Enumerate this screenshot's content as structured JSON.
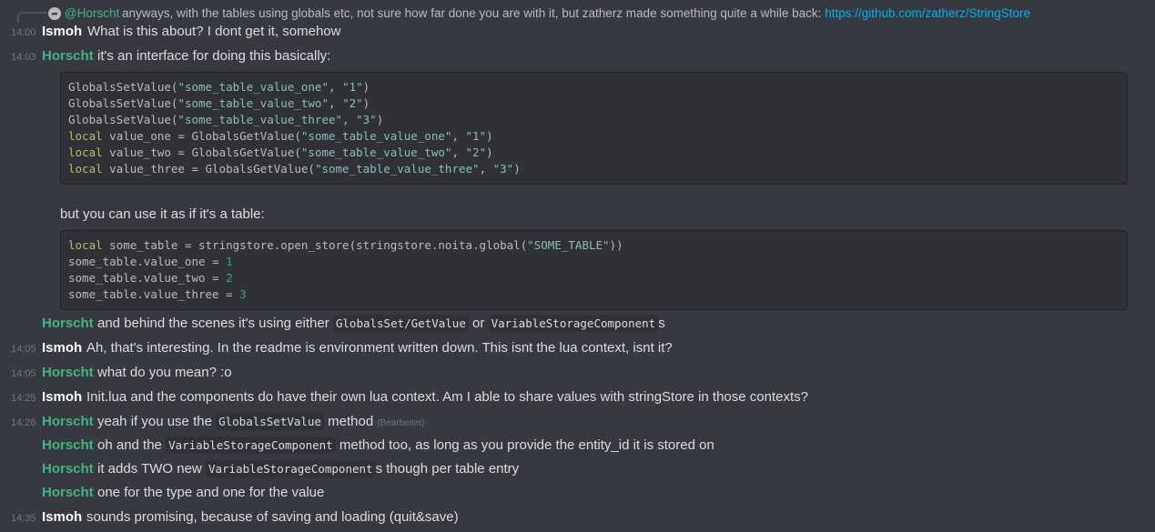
{
  "reply": {
    "mention": "@Horscht",
    "text": "anyways, with the tables using globals etc, not sure how far done you are with it, but zatherz made something quite a while back:",
    "link": "https://github.com/zatherz/StringStore"
  },
  "messages": [
    {
      "time": "14:00",
      "author": "Ismoh",
      "text": "What is this about? I dont get it, somehow"
    },
    {
      "time": "14:03",
      "author": "Horscht",
      "text": "it's an interface for doing this basically:"
    }
  ],
  "code1": [
    {
      "pre": "GlobalsSetValue(",
      "s1": "\"some_table_value_one\"",
      "mid": ", ",
      "s2": "\"1\"",
      "post": ")",
      "kw": ""
    },
    {
      "pre": "GlobalsSetValue(",
      "s1": "\"some_table_value_two\"",
      "mid": ", ",
      "s2": "\"2\"",
      "post": ")",
      "kw": ""
    },
    {
      "pre": "GlobalsSetValue(",
      "s1": "\"some_table_value_three\"",
      "mid": ", ",
      "s2": "\"3\"",
      "post": ")",
      "kw": ""
    },
    {
      "kw": "local",
      "pre": " value_one = GlobalsGetValue(",
      "s1": "\"some_table_value_one\"",
      "mid": ", ",
      "s2": "\"1\"",
      "post": ")"
    },
    {
      "kw": "local",
      "pre": " value_two = GlobalsGetValue(",
      "s1": "\"some_table_value_two\"",
      "mid": ", ",
      "s2": "\"2\"",
      "post": ")"
    },
    {
      "kw": "local",
      "pre": " value_three = GlobalsGetValue(",
      "s1": "\"some_table_value_three\"",
      "mid": ", ",
      "s2": "\"3\"",
      "post": ")"
    }
  ],
  "but_text": "but you can use it as if it's a table:",
  "code2": {
    "line1_kw": "local",
    "line1_pre": " some_table = stringstore.open_store(stringstore.noita.global(",
    "line1_str": "\"SOME_TABLE\"",
    "line1_post": "))",
    "line2_pre": "some_table.value_one = ",
    "line2_num": "1",
    "line3_pre": "some_table.value_two = ",
    "line3_num": "2",
    "line4_pre": "some_table.value_three = ",
    "line4_num": "3"
  },
  "m3": {
    "author": "Horscht",
    "t1": "and behind the scenes it's using either",
    "c1": "GlobalsSet/GetValue",
    "t2": "or",
    "c2": "VariableStorageComponent",
    "t3": "s"
  },
  "m4": {
    "time": "14:05",
    "author": "Ismoh",
    "text": "Ah, that's interesting. In the readme is environment written down. This isnt the lua context, isnt it?"
  },
  "m5": {
    "time": "14:05",
    "author": "Horscht",
    "text": "what do you mean? :o"
  },
  "m6": {
    "time": "14:25",
    "author": "Ismoh",
    "text": "Init.lua and the components do have their own lua context. Am I able to share values with stringStore in those contexts?"
  },
  "m7": {
    "time": "14:26",
    "author": "Horscht",
    "t1": "yeah if you use the",
    "c1": "GlobalsSetValue",
    "t2": "method",
    "edited": "(Bearbeitet)"
  },
  "m8": {
    "author": "Horscht",
    "t1": "oh and the",
    "c1": "VariableStorageComponent",
    "t2": "method too, as long as you provide the entity_id it is stored on"
  },
  "m9": {
    "author": "Horscht",
    "t1": "it adds TWO new",
    "c1": "VariableStorageComponent",
    "t2": "s though per table entry"
  },
  "m10": {
    "author": "Horscht",
    "text": "one for the type and one for the value"
  },
  "m11": {
    "time": "14:35",
    "author": "Ismoh",
    "text": "sounds promising, because of saving and loading (quit&save)"
  },
  "colors": {
    "background": "#36393f",
    "ismoh": "#ffffff",
    "horscht": "#43b581",
    "link": "#00b0f4"
  }
}
